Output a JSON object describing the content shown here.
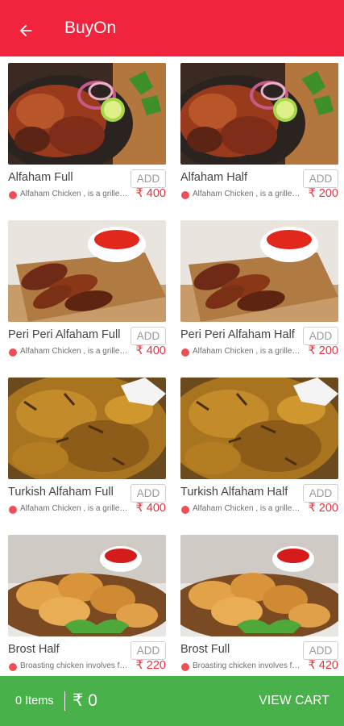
{
  "appbar": {
    "title": "BuyOn",
    "back_icon": "arrow-left-icon",
    "color": "#f2233c"
  },
  "products": [
    {
      "name": "Alfaham Full",
      "add_label": "ADD",
      "description": "Alfaham Chicken , is a grilled chicken",
      "price": "₹ 400",
      "image": "grilled-chicken"
    },
    {
      "name": "Alfaham Half",
      "add_label": "ADD",
      "description": "Alfaham Chicken , is a grilled chicken",
      "price": "₹ 200",
      "image": "grilled-chicken"
    },
    {
      "name": "Peri Peri Alfaham Full",
      "add_label": "ADD",
      "description": "Alfaham Chicken , is a grilled chicken",
      "price": "₹ 400",
      "image": "chicken-wings"
    },
    {
      "name": "Peri Peri Alfaham Half",
      "add_label": "ADD",
      "description": "Alfaham Chicken , is a grilled chicken",
      "price": "₹ 200",
      "image": "chicken-wings"
    },
    {
      "name": "Turkish Alfaham Full",
      "add_label": "ADD",
      "description": "Alfaham Chicken , is a grilled chicken",
      "price": "₹ 400",
      "image": "turkish-chicken"
    },
    {
      "name": "Turkish Alfaham Half",
      "add_label": "ADD",
      "description": "Alfaham Chicken , is a grilled chicken",
      "price": "₹ 200",
      "image": "turkish-chicken"
    },
    {
      "name": "Brost Half",
      "add_label": "ADD",
      "description": "Broasting chicken involves frying",
      "price": "₹ 220",
      "image": "fried-chicken"
    },
    {
      "name": "Brost Full",
      "add_label": "ADD",
      "description": "Broasting chicken involves frying",
      "price": "₹ 420",
      "image": "fried-chicken"
    }
  ],
  "cart": {
    "items_label": "0  Items",
    "total": "₹ 0",
    "view_cart_label": "VIEW CART",
    "color": "#48b149"
  }
}
